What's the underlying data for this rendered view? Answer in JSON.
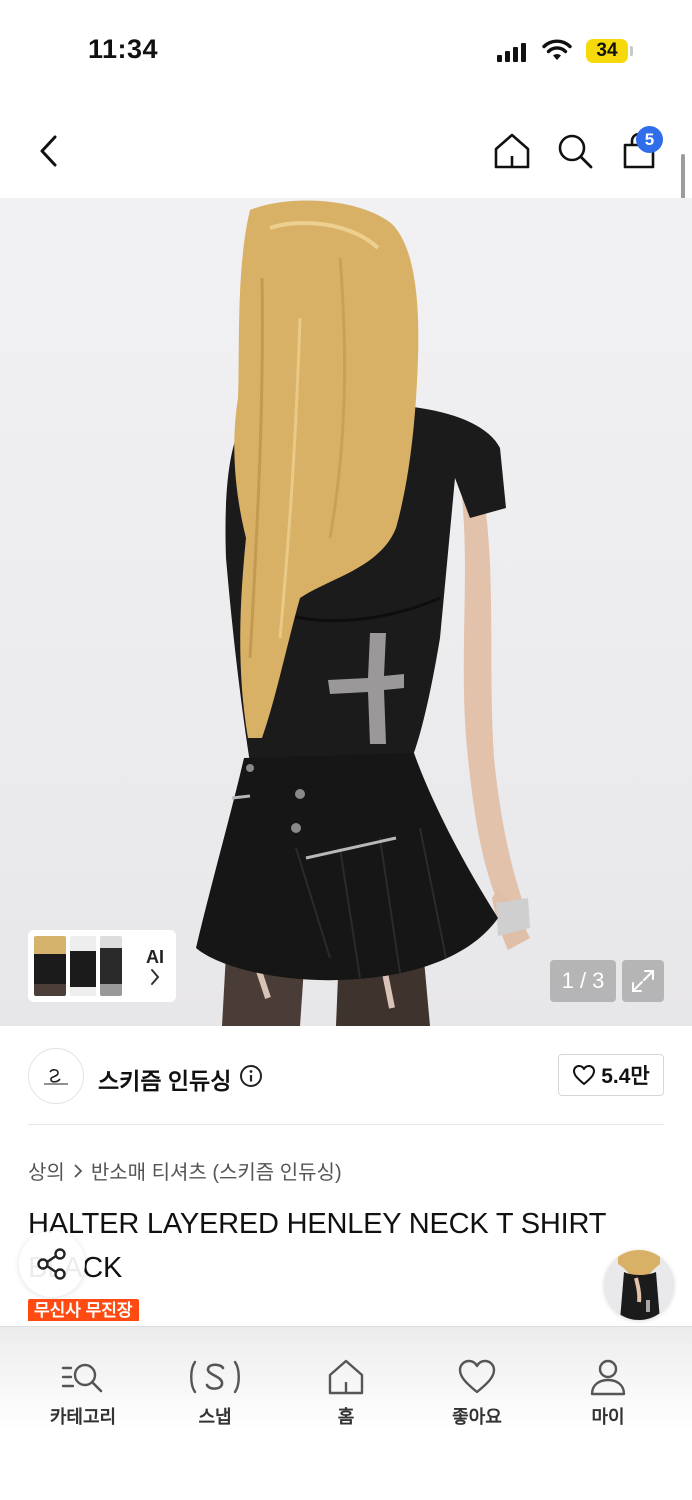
{
  "status_bar": {
    "time": "11:34",
    "battery": "34"
  },
  "top_nav": {
    "cart_count": "5"
  },
  "gallery": {
    "page_counter": "1 / 3",
    "ai_label": "AI"
  },
  "brand": {
    "name": "스키즘 인듀싱",
    "likes": "5.4만"
  },
  "breadcrumb": {
    "category": "상의",
    "subcategory": "반소매 티셔츠 (스키즘 인듀싱)"
  },
  "product": {
    "title": "HALTER LAYERED HENLEY NECK T SHIRT BLACK",
    "badge": "무신사 무진장"
  },
  "tab_bar": {
    "items": [
      {
        "label": "카테고리",
        "icon": "category-search-icon"
      },
      {
        "label": "스냅",
        "icon": "snap-icon"
      },
      {
        "label": "홈",
        "icon": "home-icon"
      },
      {
        "label": "좋아요",
        "icon": "heart-icon"
      },
      {
        "label": "마이",
        "icon": "person-icon"
      }
    ]
  },
  "colors": {
    "accent_badge": "#2f6dea",
    "promo": "#ff4b12"
  }
}
